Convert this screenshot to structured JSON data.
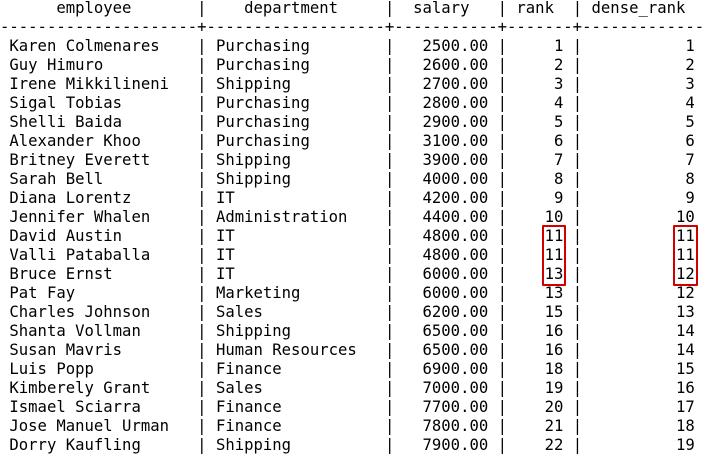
{
  "table": {
    "columns": [
      {
        "name": "employee",
        "width": 19,
        "align": "left"
      },
      {
        "name": "department",
        "width": 17,
        "align": "left"
      },
      {
        "name": "salary",
        "width": 9,
        "align": "right"
      },
      {
        "name": "rank",
        "width": 5,
        "align": "right"
      },
      {
        "name": "dense_rank",
        "width": 11,
        "align": "right"
      }
    ],
    "rows": [
      [
        "Karen Colmenares",
        "Purchasing",
        "2500.00",
        "1",
        "1"
      ],
      [
        "Guy Himuro",
        "Purchasing",
        "2600.00",
        "2",
        "2"
      ],
      [
        "Irene Mikkilineni",
        "Shipping",
        "2700.00",
        "3",
        "3"
      ],
      [
        "Sigal Tobias",
        "Purchasing",
        "2800.00",
        "4",
        "4"
      ],
      [
        "Shelli Baida",
        "Purchasing",
        "2900.00",
        "5",
        "5"
      ],
      [
        "Alexander Khoo",
        "Purchasing",
        "3100.00",
        "6",
        "6"
      ],
      [
        "Britney Everett",
        "Shipping",
        "3900.00",
        "7",
        "7"
      ],
      [
        "Sarah Bell",
        "Shipping",
        "4000.00",
        "8",
        "8"
      ],
      [
        "Diana Lorentz",
        "IT",
        "4200.00",
        "9",
        "9"
      ],
      [
        "Jennifer Whalen",
        "Administration",
        "4400.00",
        "10",
        "10"
      ],
      [
        "David Austin",
        "IT",
        "4800.00",
        "11",
        "11"
      ],
      [
        "Valli Pataballa",
        "IT",
        "4800.00",
        "11",
        "11"
      ],
      [
        "Bruce Ernst",
        "IT",
        "6000.00",
        "13",
        "12"
      ],
      [
        "Pat Fay",
        "Marketing",
        "6000.00",
        "13",
        "12"
      ],
      [
        "Charles Johnson",
        "Sales",
        "6200.00",
        "15",
        "13"
      ],
      [
        "Shanta Vollman",
        "Shipping",
        "6500.00",
        "16",
        "14"
      ],
      [
        "Susan Mavris",
        "Human Resources",
        "6500.00",
        "16",
        "14"
      ],
      [
        "Luis Popp",
        "Finance",
        "6900.00",
        "18",
        "15"
      ],
      [
        "Kimberely Grant",
        "Sales",
        "7000.00",
        "19",
        "16"
      ],
      [
        "Ismael Sciarra",
        "Finance",
        "7700.00",
        "20",
        "17"
      ],
      [
        "Jose Manuel Urman",
        "Finance",
        "7800.00",
        "21",
        "18"
      ],
      [
        "Dorry Kaufling",
        "Shipping",
        "7900.00",
        "22",
        "19"
      ]
    ]
  },
  "highlights": {
    "color": "#d00000",
    "rank_box_rows": [
      10,
      11,
      12
    ],
    "dense_rank_box_rows": [
      10,
      11,
      12
    ]
  }
}
